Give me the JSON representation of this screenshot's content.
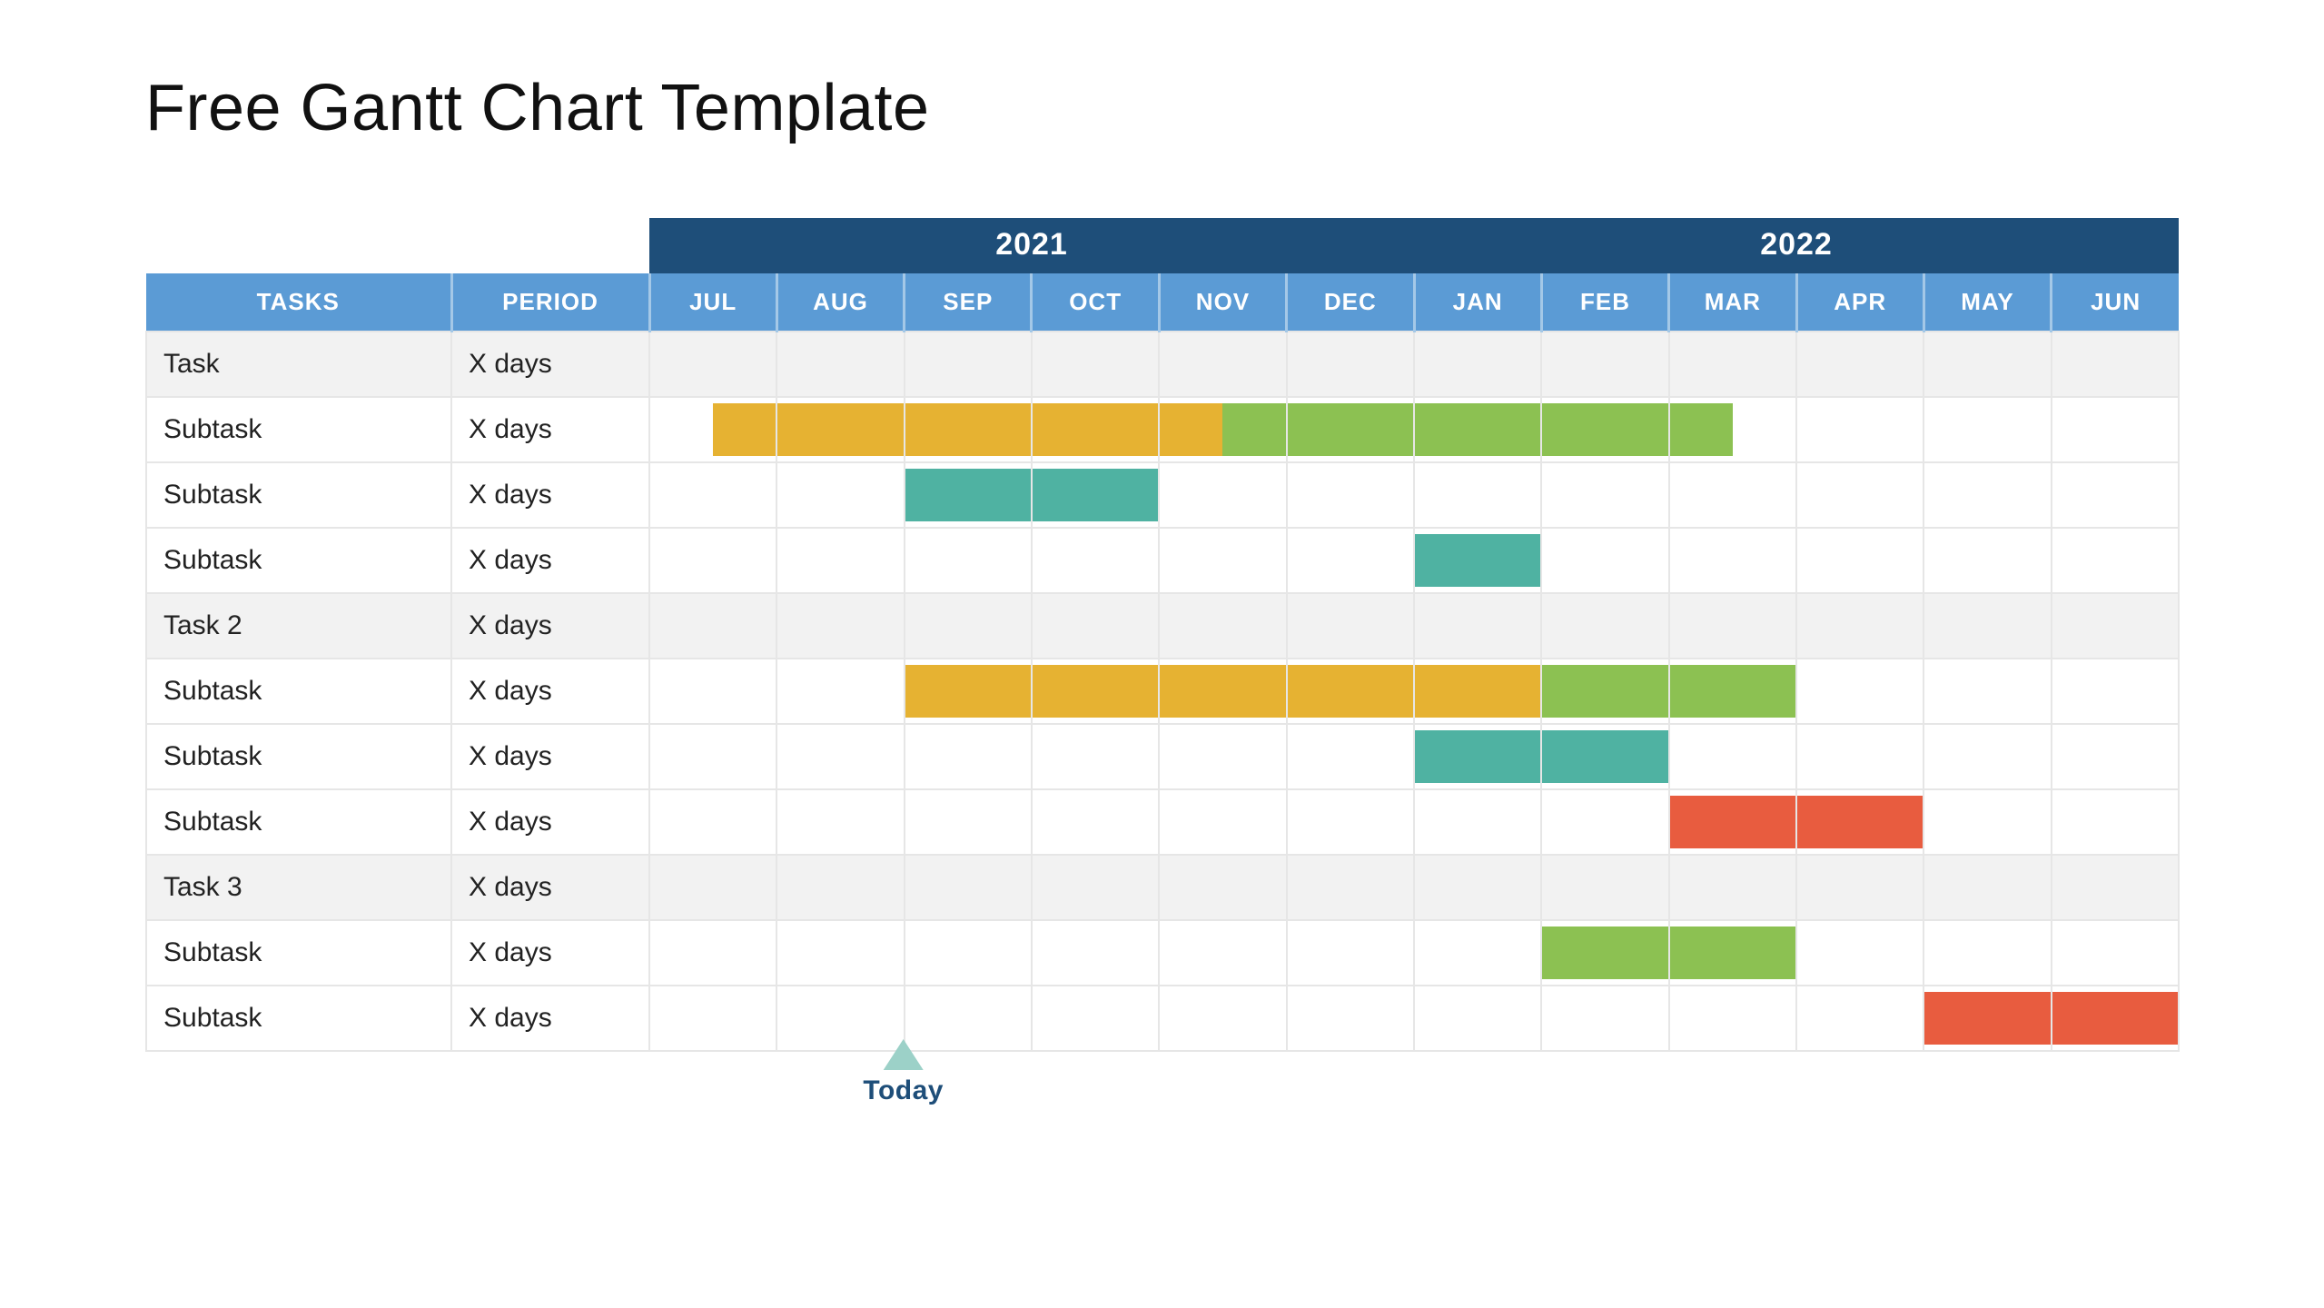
{
  "title": "Free Gantt Chart Template",
  "columns": {
    "tasks": "TASKS",
    "period": "PERIOD"
  },
  "today_label": "Today",
  "years": [
    {
      "label": "2021",
      "span": 6
    },
    {
      "label": "2022",
      "span": 6
    }
  ],
  "months": [
    "JUL",
    "AUG",
    "SEP",
    "OCT",
    "NOV",
    "DEC",
    "JAN",
    "FEB",
    "MAR",
    "APR",
    "MAY",
    "JUN"
  ],
  "rows": [
    {
      "name": "Task",
      "period": "X days",
      "group": true,
      "segments": []
    },
    {
      "name": "Subtask",
      "period": "X days",
      "group": false,
      "segments": [
        {
          "start": 0.5,
          "end": 4.5,
          "color": "#e6b232"
        },
        {
          "start": 4.5,
          "end": 8.5,
          "color": "#8cc152"
        }
      ]
    },
    {
      "name": "Subtask",
      "period": "X days",
      "group": false,
      "segments": [
        {
          "start": 2,
          "end": 4,
          "color": "#4fb2a2"
        }
      ]
    },
    {
      "name": "Subtask",
      "period": "X days",
      "group": false,
      "segments": [
        {
          "start": 6,
          "end": 7,
          "color": "#4fb2a2"
        }
      ]
    },
    {
      "name": "Task 2",
      "period": "X days",
      "group": true,
      "segments": []
    },
    {
      "name": "Subtask",
      "period": "X days",
      "group": false,
      "segments": [
        {
          "start": 2,
          "end": 7,
          "color": "#e6b232"
        },
        {
          "start": 7,
          "end": 9,
          "color": "#8cc152"
        }
      ]
    },
    {
      "name": "Subtask",
      "period": "X days",
      "group": false,
      "segments": [
        {
          "start": 6,
          "end": 8,
          "color": "#4fb2a2"
        }
      ]
    },
    {
      "name": "Subtask",
      "period": "X days",
      "group": false,
      "segments": [
        {
          "start": 8,
          "end": 10,
          "color": "#e85c3f"
        }
      ]
    },
    {
      "name": "Task 3",
      "period": "X days",
      "group": true,
      "segments": []
    },
    {
      "name": "Subtask",
      "period": "X days",
      "group": false,
      "segments": [
        {
          "start": 7,
          "end": 9,
          "color": "#8cc152"
        }
      ]
    },
    {
      "name": "Subtask",
      "period": "X days",
      "group": false,
      "segments": [
        {
          "start": 10,
          "end": 12,
          "color": "#e85c3f"
        }
      ]
    }
  ],
  "today_month_index": 2,
  "chart_data": {
    "type": "bar",
    "title": "Free Gantt Chart Template",
    "categories": [
      "JUL",
      "AUG",
      "SEP",
      "OCT",
      "NOV",
      "DEC",
      "JAN",
      "FEB",
      "MAR",
      "APR",
      "MAY",
      "JUN"
    ],
    "year_groups": [
      {
        "label": "2021",
        "months": [
          "JUL",
          "AUG",
          "SEP",
          "OCT",
          "NOV",
          "DEC"
        ]
      },
      {
        "label": "2022",
        "months": [
          "JAN",
          "FEB",
          "MAR",
          "APR",
          "MAY",
          "JUN"
        ]
      }
    ],
    "xlabel": "",
    "ylabel": "",
    "today": {
      "label": "Today",
      "position_months": 2
    },
    "series": [
      {
        "name": "Task",
        "group": true,
        "period": "X days",
        "bars": []
      },
      {
        "name": "Subtask",
        "group": false,
        "period": "X days",
        "bars": [
          {
            "start": 0.5,
            "end": 4.5,
            "color": "#e6b232"
          },
          {
            "start": 4.5,
            "end": 8.5,
            "color": "#8cc152"
          }
        ]
      },
      {
        "name": "Subtask",
        "group": false,
        "period": "X days",
        "bars": [
          {
            "start": 2,
            "end": 4,
            "color": "#4fb2a2"
          }
        ]
      },
      {
        "name": "Subtask",
        "group": false,
        "period": "X days",
        "bars": [
          {
            "start": 6,
            "end": 7,
            "color": "#4fb2a2"
          }
        ]
      },
      {
        "name": "Task 2",
        "group": true,
        "period": "X days",
        "bars": []
      },
      {
        "name": "Subtask",
        "group": false,
        "period": "X days",
        "bars": [
          {
            "start": 2,
            "end": 7,
            "color": "#e6b232"
          },
          {
            "start": 7,
            "end": 9,
            "color": "#8cc152"
          }
        ]
      },
      {
        "name": "Subtask",
        "group": false,
        "period": "X days",
        "bars": [
          {
            "start": 6,
            "end": 8,
            "color": "#4fb2a2"
          }
        ]
      },
      {
        "name": "Subtask",
        "group": false,
        "period": "X days",
        "bars": [
          {
            "start": 8,
            "end": 10,
            "color": "#e85c3f"
          }
        ]
      },
      {
        "name": "Task 3",
        "group": true,
        "period": "X days",
        "bars": []
      },
      {
        "name": "Subtask",
        "group": false,
        "period": "X days",
        "bars": [
          {
            "start": 7,
            "end": 9,
            "color": "#8cc152"
          }
        ]
      },
      {
        "name": "Subtask",
        "group": false,
        "period": "X days",
        "bars": [
          {
            "start": 10,
            "end": 12,
            "color": "#e85c3f"
          }
        ]
      }
    ]
  }
}
